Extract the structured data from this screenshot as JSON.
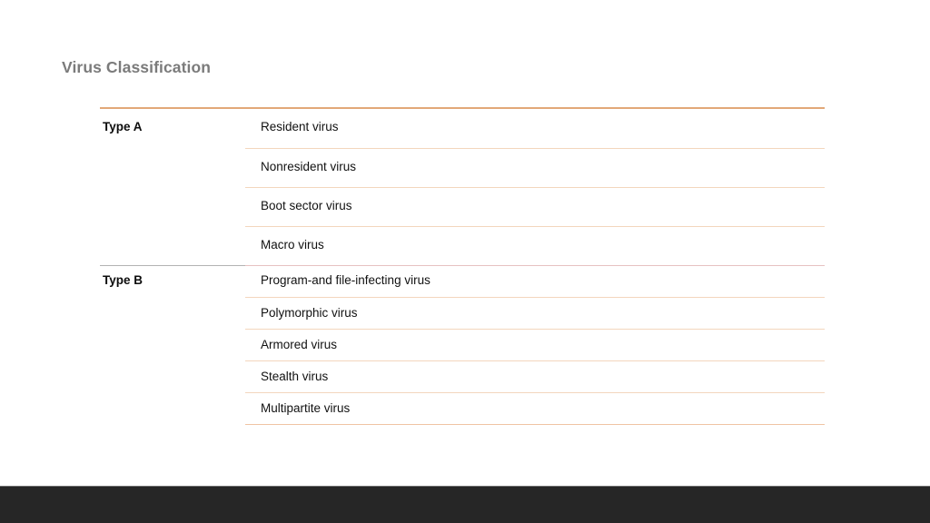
{
  "slide": {
    "title": "Virus Classification",
    "background_color": "#ffffff",
    "title_color": "#7b7b7b",
    "footer_color": "#262626",
    "accent_rule_color": "#e2a878",
    "inner_rule_color": "#f3d6bd",
    "group_sep_left_color": "#b3b3b3",
    "group_sep_right_color": "#e6c2c2"
  },
  "table": {
    "groups": [
      {
        "label": "Type A",
        "rows": [
          {
            "name": "Resident virus"
          },
          {
            "name": "Nonresident virus"
          },
          {
            "name": "Boot sector virus"
          },
          {
            "name": "Macro virus"
          }
        ]
      },
      {
        "label": "Type B",
        "rows": [
          {
            "name": "Program-and file-infecting virus"
          },
          {
            "name": "Polymorphic virus"
          },
          {
            "name": "Armored virus"
          },
          {
            "name": "Stealth virus"
          },
          {
            "name": "Multipartite virus"
          }
        ]
      }
    ]
  }
}
